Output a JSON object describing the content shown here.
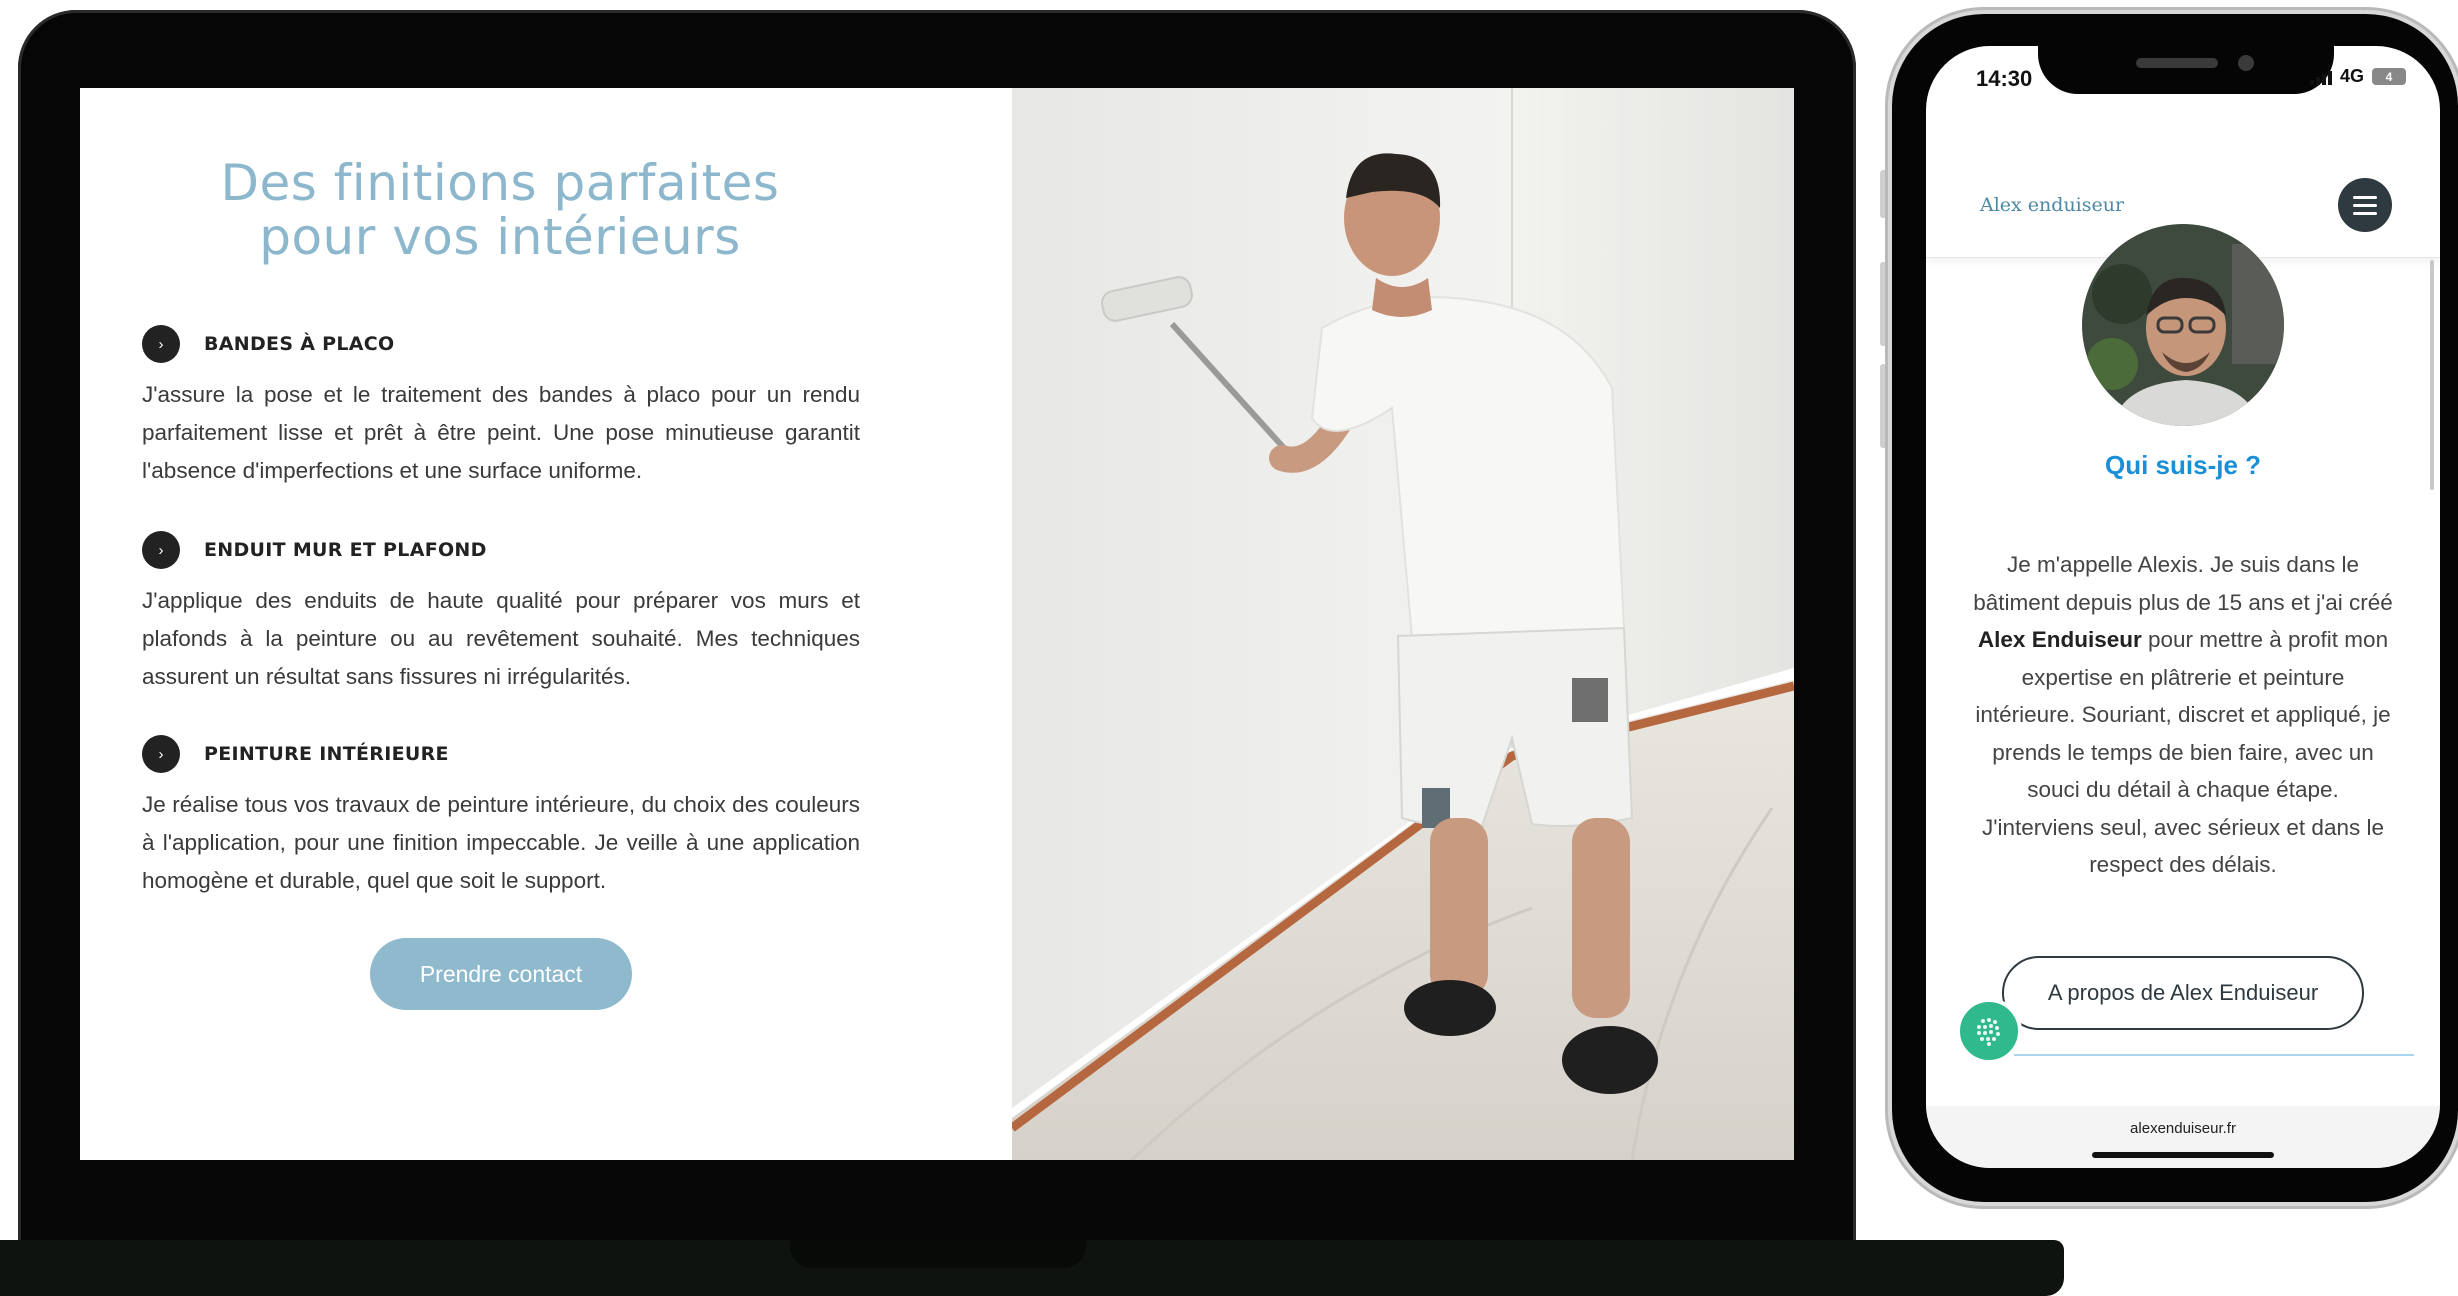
{
  "desktop": {
    "hero_title_line1": "Des finitions parfaites",
    "hero_title_line2": "pour vos intérieurs",
    "services": [
      {
        "title": "BANDES À PLACO",
        "text": "J'assure la pose et le traitement des bandes à placo pour un rendu parfaitement lisse et prêt à être peint. Une pose minutieuse garantit l'absence d'imperfections et une surface uniforme."
      },
      {
        "title": "ENDUIT MUR ET PLAFOND",
        "text": "J'applique des enduits de haute qualité pour préparer vos murs et plafonds à la peinture ou au revêtement souhaité. Mes techniques assurent un résultat sans fissures ni irrégularités."
      },
      {
        "title": "PEINTURE INTÉRIEURE",
        "text": "Je réalise tous vos travaux de peinture intérieure, du choix des couleurs à l'application, pour une finition impeccable. Je veille à une application homogène et durable, quel que soit le support."
      }
    ],
    "bullet_icon": "chevron-right-icon",
    "bullet_glyph": "›",
    "contact_label": "Prendre contact",
    "accent_color": "#8cb7cc"
  },
  "mobile": {
    "status_time": "14:30",
    "network": "4G",
    "battery": "4",
    "brand": "Alex enduiseur",
    "section_title": "Qui suis-je ?",
    "bio_part1": "Je m'appelle Alexis. Je suis dans le bâtiment depuis plus de 15 ans et j'ai créé ",
    "bio_bold": "Alex Enduiseur",
    "bio_part2": " pour mettre à profit mon expertise en plâtrerie et peinture intérieure. Souriant, discret et appliqué, je prends le temps de bien faire, avec un souci du détail à chaque étape.",
    "bio_part3": "J'interviens seul, avec sérieux et dans le respect des délais.",
    "about_label": "A propos de Alex Enduiseur",
    "url": "alexenduiseur.fr",
    "title_color": "#1b8fd6"
  }
}
